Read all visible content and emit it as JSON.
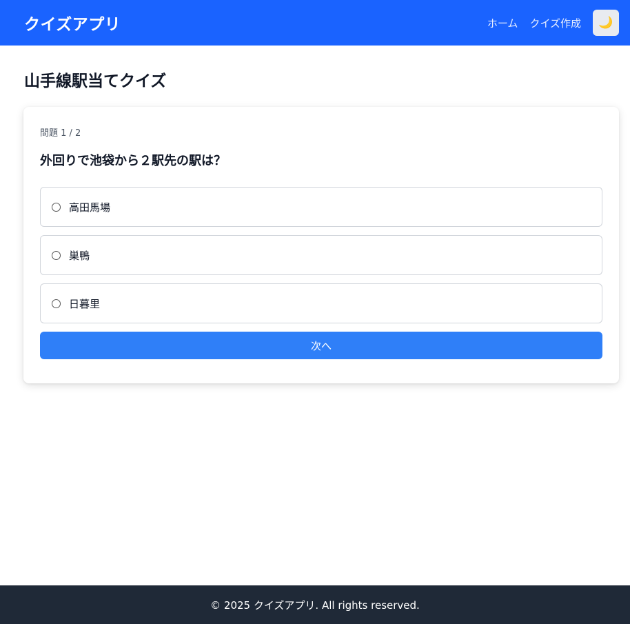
{
  "header": {
    "brand": "クイズアプリ",
    "nav": [
      {
        "label": "ホーム"
      },
      {
        "label": "クイズ作成"
      }
    ],
    "theme_toggle_icon": "moon-icon"
  },
  "page": {
    "title": "山手線駅当てクイズ"
  },
  "quiz": {
    "progress": "問題 1 / 2",
    "question": "外回りで池袋から２駅先の駅は？",
    "options": [
      {
        "label": "高田馬場"
      },
      {
        "label": "巣鴨"
      },
      {
        "label": "日暮里"
      }
    ],
    "next_label": "次へ"
  },
  "footer": {
    "text": "© 2025 クイズアプリ. All rights reserved."
  },
  "colors": {
    "header_bg": "#1a63ff",
    "button_bg": "#2f7ff8",
    "footer_bg": "#1f2937"
  }
}
